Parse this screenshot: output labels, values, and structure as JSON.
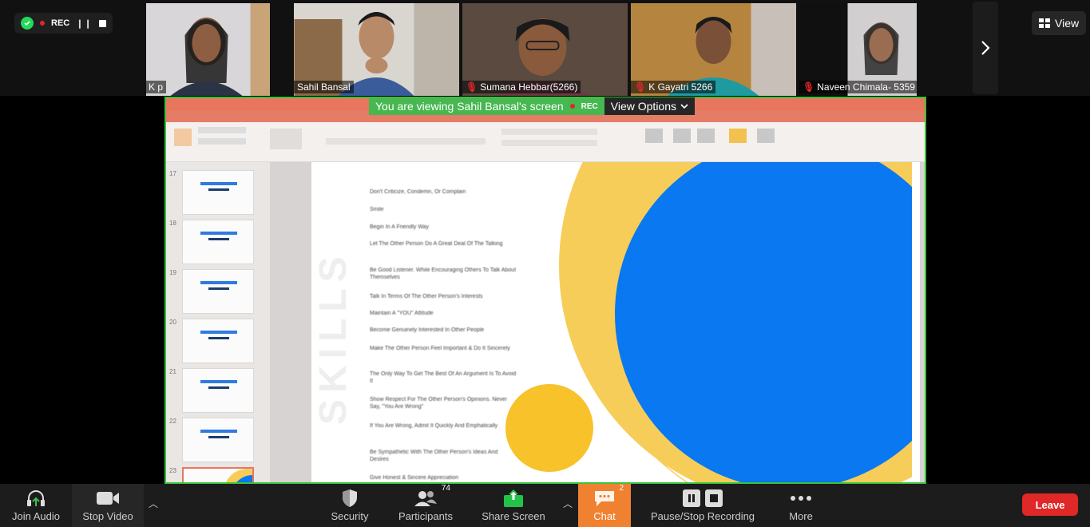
{
  "recording": {
    "label": "REC",
    "pause_glyph": "❙❙"
  },
  "participants_strip": [
    {
      "name": "Gifty K p",
      "muted": false
    },
    {
      "name": "Sahil Bansal",
      "muted": false
    },
    {
      "name": "Sumana Hebbar(5266)",
      "muted": true
    },
    {
      "name": "K Gayatri 5266",
      "muted": true
    },
    {
      "name": "Naveen Chimala- 5359",
      "muted": true
    }
  ],
  "view_button": {
    "label": "View"
  },
  "share_banner": {
    "text": "You are viewing Sahil Bansal's screen",
    "rec": "REC",
    "view_options": "View Options"
  },
  "slide": {
    "thumb_numbers": [
      "17",
      "18",
      "19",
      "20",
      "21",
      "22",
      "23"
    ],
    "items": [
      "Don't Criticize, Condemn, Or Complain",
      "Smile",
      "Begin In A Friendly Way",
      "Let The Other Person Do A Great Deal Of The Talking",
      "Be Good Listener. While Encouraging Others To Talk About Themselves",
      "Talk In Terms Of The Other Person's Interests",
      "Maintain A \"YOU\" Attitude",
      "Become Genuinely Interested In Other People",
      "Make The Other Person Feel Important & Do It Sincerely",
      "The Only Way To Get The Best Of An Argument Is To Avoid It",
      "Show Respect For The Other Person's Opinions. Never Say, \"You Are Wrong\"",
      "If You Are Wrong, Admit It Quickly And Emphatically",
      "Be Sympathetic With The Other Person's Ideas And Desires",
      "Give Honest & Sincere Appreciation"
    ],
    "vertical_text": "SKILLS"
  },
  "toolbar": {
    "join_audio": "Join Audio",
    "stop_video": "Stop Video",
    "security": "Security",
    "participants": "Participants",
    "participants_count": "74",
    "share_screen": "Share Screen",
    "chat": "Chat",
    "chat_count": "2",
    "pause_stop_recording": "Pause/Stop Recording",
    "more": "More",
    "leave": "Leave"
  },
  "colors": {
    "accent_green": "#39c33b",
    "leave_red": "#e02828",
    "chat_orange": "#f08130",
    "ppt_orange": "#e8765e",
    "slide_blue": "#0a78f0",
    "slide_yellow": "#f7cd5a"
  }
}
